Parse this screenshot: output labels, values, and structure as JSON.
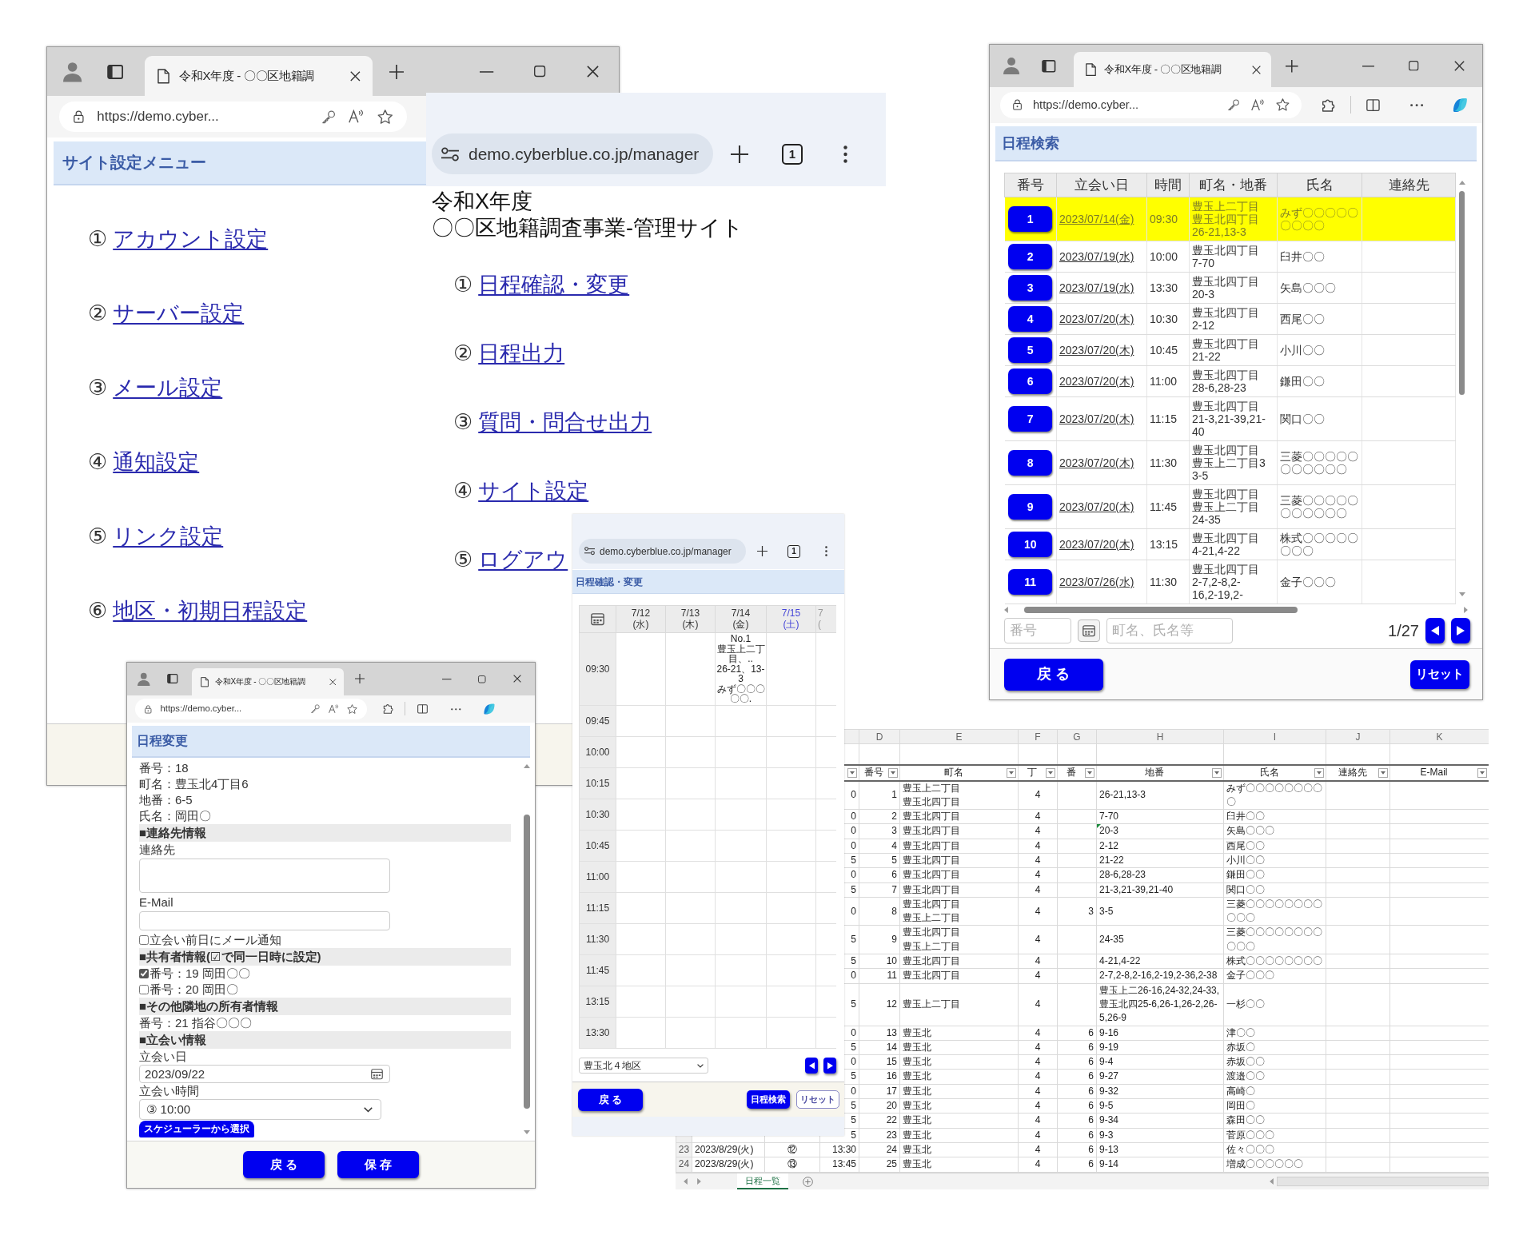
{
  "settings_window": {
    "tab_title": "令和X年度 - 〇〇区地籍調",
    "address": "https://demo.cyber...",
    "heading": "サイト設定メニュー",
    "links": [
      {
        "number": "①",
        "label": "アカウント設定"
      },
      {
        "number": "②",
        "label": "サーバー設定"
      },
      {
        "number": "③",
        "label": "メール設定"
      },
      {
        "number": "④",
        "label": "通知設定"
      },
      {
        "number": "⑤",
        "label": "リンク設定"
      },
      {
        "number": "⑥",
        "label": "地区・初期日程設定"
      }
    ]
  },
  "portal_window": {
    "address": "demo.cyberblue.co.jp/manager",
    "tab_count": "1",
    "title_lines": [
      "令和X年度",
      "〇〇区地籍調査事業-管理サイト"
    ],
    "links": [
      {
        "number": "①",
        "label": "日程確認・変更"
      },
      {
        "number": "②",
        "label": "日程出力"
      },
      {
        "number": "③",
        "label": "質問・問合せ出力"
      },
      {
        "number": "④",
        "label": "サイト設定"
      },
      {
        "number": "⑤",
        "label": "ログアウ"
      }
    ]
  },
  "search_window": {
    "tab_title": "令和X年度 - 〇〇区地籍調",
    "address": "https://demo.cyber...",
    "extra_toolbar_buttons": true,
    "heading": "日程検索",
    "table": {
      "columns": [
        "番号",
        "立会い日",
        "時間",
        "町名・地番",
        "氏名",
        "連絡先"
      ],
      "rows": [
        {
          "number": "1",
          "date": "2023/07/14(金)",
          "time": "09:30",
          "towns": [
            "豊玉上二丁目",
            "豊玉北四丁目"
          ],
          "lot": "26-21,13-3",
          "name": "みず〇〇〇〇〇〇〇〇〇",
          "selected": true
        },
        {
          "number": "2",
          "date": "2023/07/19(水)",
          "time": "10:00",
          "towns": [
            "豊玉北四丁目"
          ],
          "lot": "7-70",
          "name": "臼井〇〇",
          "selected": false
        },
        {
          "number": "3",
          "date": "2023/07/19(水)",
          "time": "13:30",
          "towns": [
            "豊玉北四丁目"
          ],
          "lot": "20-3",
          "name": "矢島〇〇〇",
          "selected": false
        },
        {
          "number": "4",
          "date": "2023/07/20(木)",
          "time": "10:30",
          "towns": [
            "豊玉北四丁目"
          ],
          "lot": "2-12",
          "name": "西尾〇〇",
          "selected": false
        },
        {
          "number": "5",
          "date": "2023/07/20(木)",
          "time": "10:45",
          "towns": [
            "豊玉北四丁目"
          ],
          "lot": "21-22",
          "name": "小川〇〇",
          "selected": false
        },
        {
          "number": "6",
          "date": "2023/07/20(木)",
          "time": "11:00",
          "towns": [
            "豊玉北四丁目"
          ],
          "lot": "28-6,28-23",
          "name": "鎌田〇〇",
          "selected": false
        },
        {
          "number": "7",
          "date": "2023/07/20(木)",
          "time": "11:15",
          "towns": [
            "豊玉北四丁目"
          ],
          "lot": "21-3,21-39,21-\n40",
          "name": "関口〇〇",
          "selected": false
        },
        {
          "number": "8",
          "date": "2023/07/20(木)",
          "time": "11:30",
          "towns": [
            "豊玉北四丁目",
            "豊玉上二丁目3"
          ],
          "lot": "3-5",
          "name": "三菱〇〇〇〇〇〇〇〇〇〇〇",
          "selected": false
        },
        {
          "number": "9",
          "date": "2023/07/20(木)",
          "time": "11:45",
          "towns": [
            "豊玉北四丁目",
            "豊玉上二丁目"
          ],
          "lot": "24-35",
          "name": "三菱〇〇〇〇〇〇〇〇〇〇〇",
          "selected": false
        },
        {
          "number": "10",
          "date": "2023/07/20(木)",
          "time": "13:15",
          "towns": [
            "豊玉北四丁目"
          ],
          "lot": "4-21,4-22",
          "name": "株式〇〇〇〇〇〇〇〇",
          "selected": false
        },
        {
          "number": "11",
          "date": "2023/07/26(水)",
          "time": "11:30",
          "towns": [
            "豊玉北四丁目"
          ],
          "lot": "2-7,2-8,2-\n16,2-19,2-",
          "name": "金子〇〇〇",
          "selected": false
        }
      ]
    },
    "number_placeholder": "番号",
    "keyword_placeholder": "町名、氏名等",
    "page": "1/27",
    "back_button": "戻 る",
    "reset_button": "リセット"
  },
  "edit_window": {
    "tab_title": "令和X年度 - 〇〇区地籍調",
    "address": "https://demo.cyber...",
    "extra_toolbar_buttons": true,
    "heading": "日程変更",
    "items": [
      {
        "kind": "text",
        "text": "番号：18"
      },
      {
        "kind": "text",
        "text": "町名：豊玉北4丁目6"
      },
      {
        "kind": "text",
        "text": "地番：6-5"
      },
      {
        "kind": "text",
        "text": "氏名：岡田〇"
      },
      {
        "kind": "section",
        "text": "■連絡先情報"
      },
      {
        "kind": "label",
        "text": "連絡先"
      },
      {
        "kind": "textarea"
      },
      {
        "kind": "label",
        "text": "E-Mail"
      },
      {
        "kind": "input"
      },
      {
        "kind": "checkbox",
        "text": "立会い前日にメール通知",
        "checked": false
      },
      {
        "kind": "section",
        "text": "■共有者情報(☑で同一日時に設定)"
      },
      {
        "kind": "checkbox",
        "text": "番号：19 岡田〇〇",
        "checked": true
      },
      {
        "kind": "checkbox",
        "text": "番号：20 岡田〇",
        "checked": false
      },
      {
        "kind": "section",
        "text": "■その他隣地の所有者情報"
      },
      {
        "kind": "text",
        "text": "番号：21 指谷〇〇〇"
      },
      {
        "kind": "section",
        "text": "■立会い情報"
      },
      {
        "kind": "label",
        "text": "立会い日"
      },
      {
        "kind": "date",
        "value": "2023/09/22"
      },
      {
        "kind": "label",
        "text": "立会い時間"
      },
      {
        "kind": "select",
        "value": "③ 10:00"
      },
      {
        "kind": "button",
        "text": "スケジューラーから選択"
      }
    ],
    "buttons": [
      "戻 る",
      "保 存"
    ]
  },
  "calendar_window": {
    "address": "demo.cyberblue.co.jp/manager",
    "tab_count": "1",
    "heading": "日程確認・変更",
    "days": [
      {
        "date": "7/12",
        "weekday": "(水)",
        "kind": "weekday"
      },
      {
        "date": "7/13",
        "weekday": "(木)",
        "kind": "weekday"
      },
      {
        "date": "7/14",
        "weekday": "(金)",
        "kind": "weekday"
      },
      {
        "date": "7/15",
        "weekday": "(土)",
        "kind": "saturday"
      },
      {
        "date": "7",
        "weekday": "(",
        "kind": "cut"
      }
    ],
    "time_rows": [
      {
        "time": "09:30",
        "cells": [
          null,
          null,
          {
            "lines": [
              "No.1",
              "豊玉上二丁目、..",
              "26-21、13-3",
              "みず〇〇〇〇〇."
            ]
          },
          null,
          null
        ]
      },
      {
        "time": "09:45"
      },
      {
        "time": "10:00"
      },
      {
        "time": "10:15"
      },
      {
        "time": "10:30"
      },
      {
        "time": "10:45"
      },
      {
        "time": "11:00"
      },
      {
        "time": "11:15"
      },
      {
        "time": "11:30"
      },
      {
        "time": "11:45"
      },
      {
        "time": "13:15"
      },
      {
        "time": "13:30"
      }
    ],
    "district": "豊玉北４地区",
    "back_button": "戻 る",
    "search_button": "日程検索",
    "reset_button": "リセット"
  },
  "spreadsheet": {
    "column_letters": [
      "D",
      "E",
      "F",
      "G",
      "H",
      "I",
      "J",
      "K"
    ],
    "headers": [
      "番号",
      "町名",
      "丁",
      "番",
      "地番",
      "氏名",
      "連絡先",
      "E-Mail"
    ],
    "rows": [
      {
        "column_3": "0",
        "number": "1",
        "towns": [
          "豊玉上二丁目",
          "豊玉北四丁目"
        ],
        "chome": "4",
        "lot": "26-21,13-3",
        "name": "みず〇〇〇〇〇〇〇〇〇",
        "flagged": false
      },
      {
        "column_3": "0",
        "number": "2",
        "towns": [
          "豊玉北四丁目"
        ],
        "chome": "4",
        "lot": "7-70",
        "name": "臼井〇〇",
        "flagged": false
      },
      {
        "column_3": "0",
        "number": "3",
        "towns": [
          "豊玉北四丁目"
        ],
        "chome": "4",
        "lot": "20-3",
        "name": "矢島〇〇〇",
        "flagged": true
      },
      {
        "column_3": "0",
        "number": "4",
        "towns": [
          "豊玉北四丁目"
        ],
        "chome": "4",
        "lot": "2-12",
        "name": "西尾〇〇",
        "flagged": false
      },
      {
        "column_3": "5",
        "number": "5",
        "towns": [
          "豊玉北四丁目"
        ],
        "chome": "4",
        "lot": "21-22",
        "name": "小川〇〇",
        "flagged": false
      },
      {
        "column_3": "0",
        "number": "6",
        "towns": [
          "豊玉北四丁目"
        ],
        "chome": "4",
        "lot": "28-6,28-23",
        "name": "鎌田〇〇",
        "flagged": false
      },
      {
        "column_3": "5",
        "number": "7",
        "towns": [
          "豊玉北四丁目"
        ],
        "chome": "4",
        "lot": "21-3,21-39,21-40",
        "name": "関口〇〇",
        "flagged": false
      },
      {
        "column_3": "0",
        "number": "8",
        "towns": [
          "豊玉北四丁目",
          "豊玉上二丁目"
        ],
        "chome": "4",
        "ban": "3",
        "lot": "3-5",
        "name": "三菱〇〇〇〇〇〇〇〇〇〇〇",
        "flagged": false
      },
      {
        "column_3": "5",
        "number": "9",
        "towns": [
          "豊玉北四丁目",
          "豊玉上二丁目"
        ],
        "chome": "4",
        "lot": "24-35",
        "name": "三菱〇〇〇〇〇〇〇〇〇〇〇",
        "flagged": false
      },
      {
        "column_3": "5",
        "number": "10",
        "towns": [
          "豊玉北四丁目"
        ],
        "chome": "4",
        "lot": "4-21,4-22",
        "name": "株式〇〇〇〇〇〇〇〇",
        "flagged": false
      },
      {
        "column_3": "0",
        "number": "11",
        "towns": [
          "豊玉北四丁目"
        ],
        "chome": "4",
        "lot": "2-7,2-8,2-16,2-19,2-36,2-38",
        "name": "金子〇〇〇",
        "flagged": false
      },
      {
        "column_3": "5",
        "number": "12",
        "towns": [
          "豊玉上二丁目"
        ],
        "chome": "4",
        "lot": "豊玉上二26-16,24-32,24-33,豊玉北四25-6,26-1,26-2,26-5,26-9",
        "name": "一杉〇〇",
        "flagged": false
      },
      {
        "column_3": "0",
        "number": "13",
        "towns": [
          "豊玉北"
        ],
        "chome": "4",
        "ban": "6",
        "lot": "9-16",
        "name": "津〇〇",
        "flagged": false
      },
      {
        "column_3": "5",
        "number": "14",
        "towns": [
          "豊玉北"
        ],
        "chome": "4",
        "ban": "6",
        "lot": "9-19",
        "name": "赤坂〇",
        "flagged": false
      },
      {
        "column_3": "0",
        "number": "15",
        "towns": [
          "豊玉北"
        ],
        "chome": "4",
        "ban": "6",
        "lot": "9-4",
        "name": "赤坂〇〇",
        "flagged": false
      },
      {
        "column_3": "5",
        "number": "16",
        "towns": [
          "豊玉北"
        ],
        "chome": "4",
        "ban": "6",
        "lot": "9-27",
        "name": "渡邉〇〇",
        "flagged": false
      },
      {
        "column_3": "0",
        "number": "17",
        "towns": [
          "豊玉北"
        ],
        "chome": "4",
        "ban": "6",
        "lot": "9-32",
        "name": "高崎〇",
        "flagged": false
      },
      {
        "column_3": "5",
        "number": "20",
        "towns": [
          "豊玉北"
        ],
        "chome": "4",
        "ban": "6",
        "lot": "9-5",
        "name": "岡田〇",
        "flagged": false
      },
      {
        "column_3": "5",
        "number": "22",
        "towns": [
          "豊玉北"
        ],
        "chome": "4",
        "ban": "6",
        "lot": "9-34",
        "name": "森田〇〇",
        "flagged": false
      },
      {
        "column_3": "5",
        "number": "23",
        "towns": [
          "豊玉北"
        ],
        "chome": "4",
        "ban": "6",
        "lot": "9-3",
        "name": "菅原〇〇〇",
        "flagged": false
      },
      {
        "row_number": "23",
        "column_1": "2023/8/29(火)",
        "column_2": "⑫",
        "column_3": "13:30",
        "number": "24",
        "towns": [
          "豊玉北"
        ],
        "chome": "4",
        "ban": "6",
        "lot": "9-13",
        "name": "佐々〇〇〇",
        "flagged": false
      },
      {
        "row_number": "24",
        "column_1": "2023/8/29(火)",
        "column_2": "⑬",
        "column_3": "13:45",
        "number": "25",
        "towns": [
          "豊玉北"
        ],
        "chome": "4",
        "ban": "6",
        "lot": "9-14",
        "name": "増成〇〇〇〇〇〇",
        "flagged": false
      }
    ],
    "sheet_tab": "日程一覧"
  }
}
